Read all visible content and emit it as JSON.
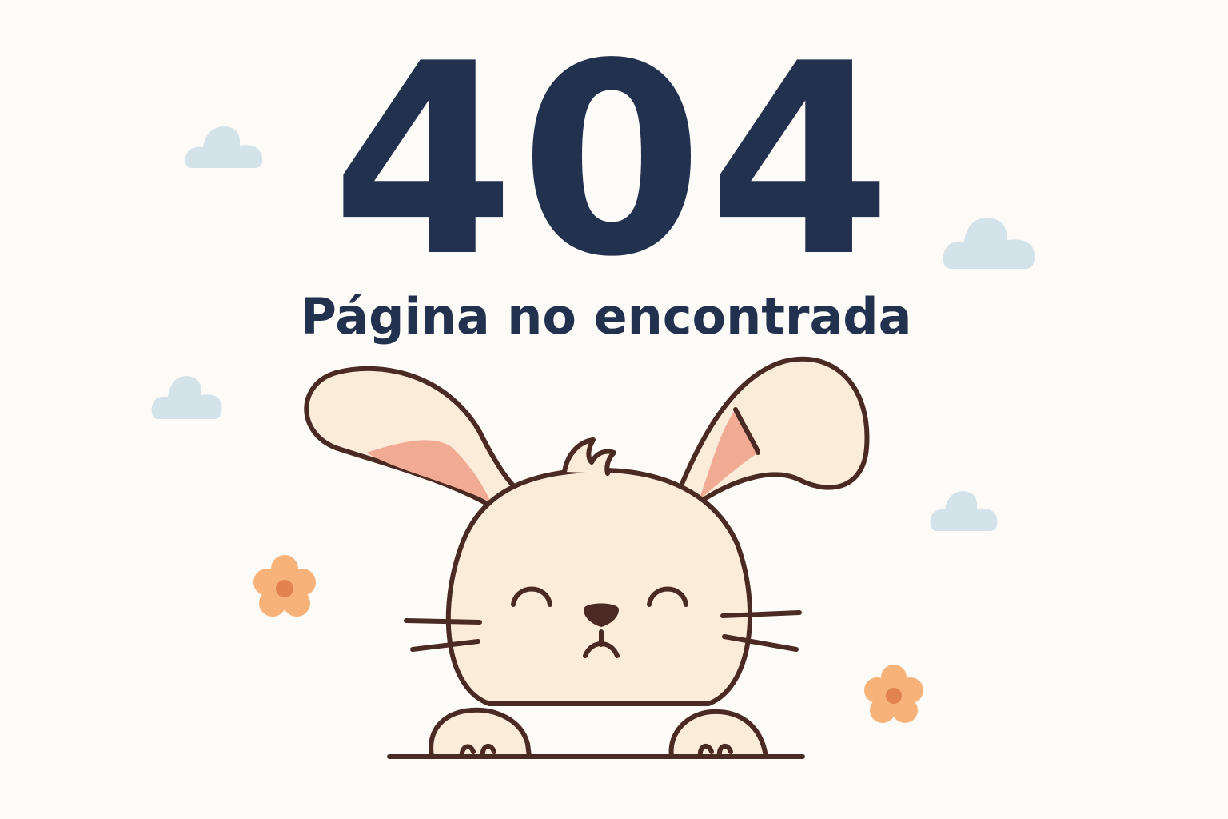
{
  "error": {
    "code": "404",
    "message": "Página no encontrada"
  },
  "colors": {
    "background": "#fdfbf7",
    "text": "#22314d",
    "cloud": "#d4e3ea",
    "flower_petal": "#f7b27a",
    "flower_center": "#e2824e",
    "bunny_fur": "#fbebd9",
    "bunny_ear_inner": "#f1ab95",
    "outline": "#4a2a22"
  },
  "illustration": {
    "subject": "sad-bunny",
    "clouds": 4,
    "flowers": 2
  }
}
